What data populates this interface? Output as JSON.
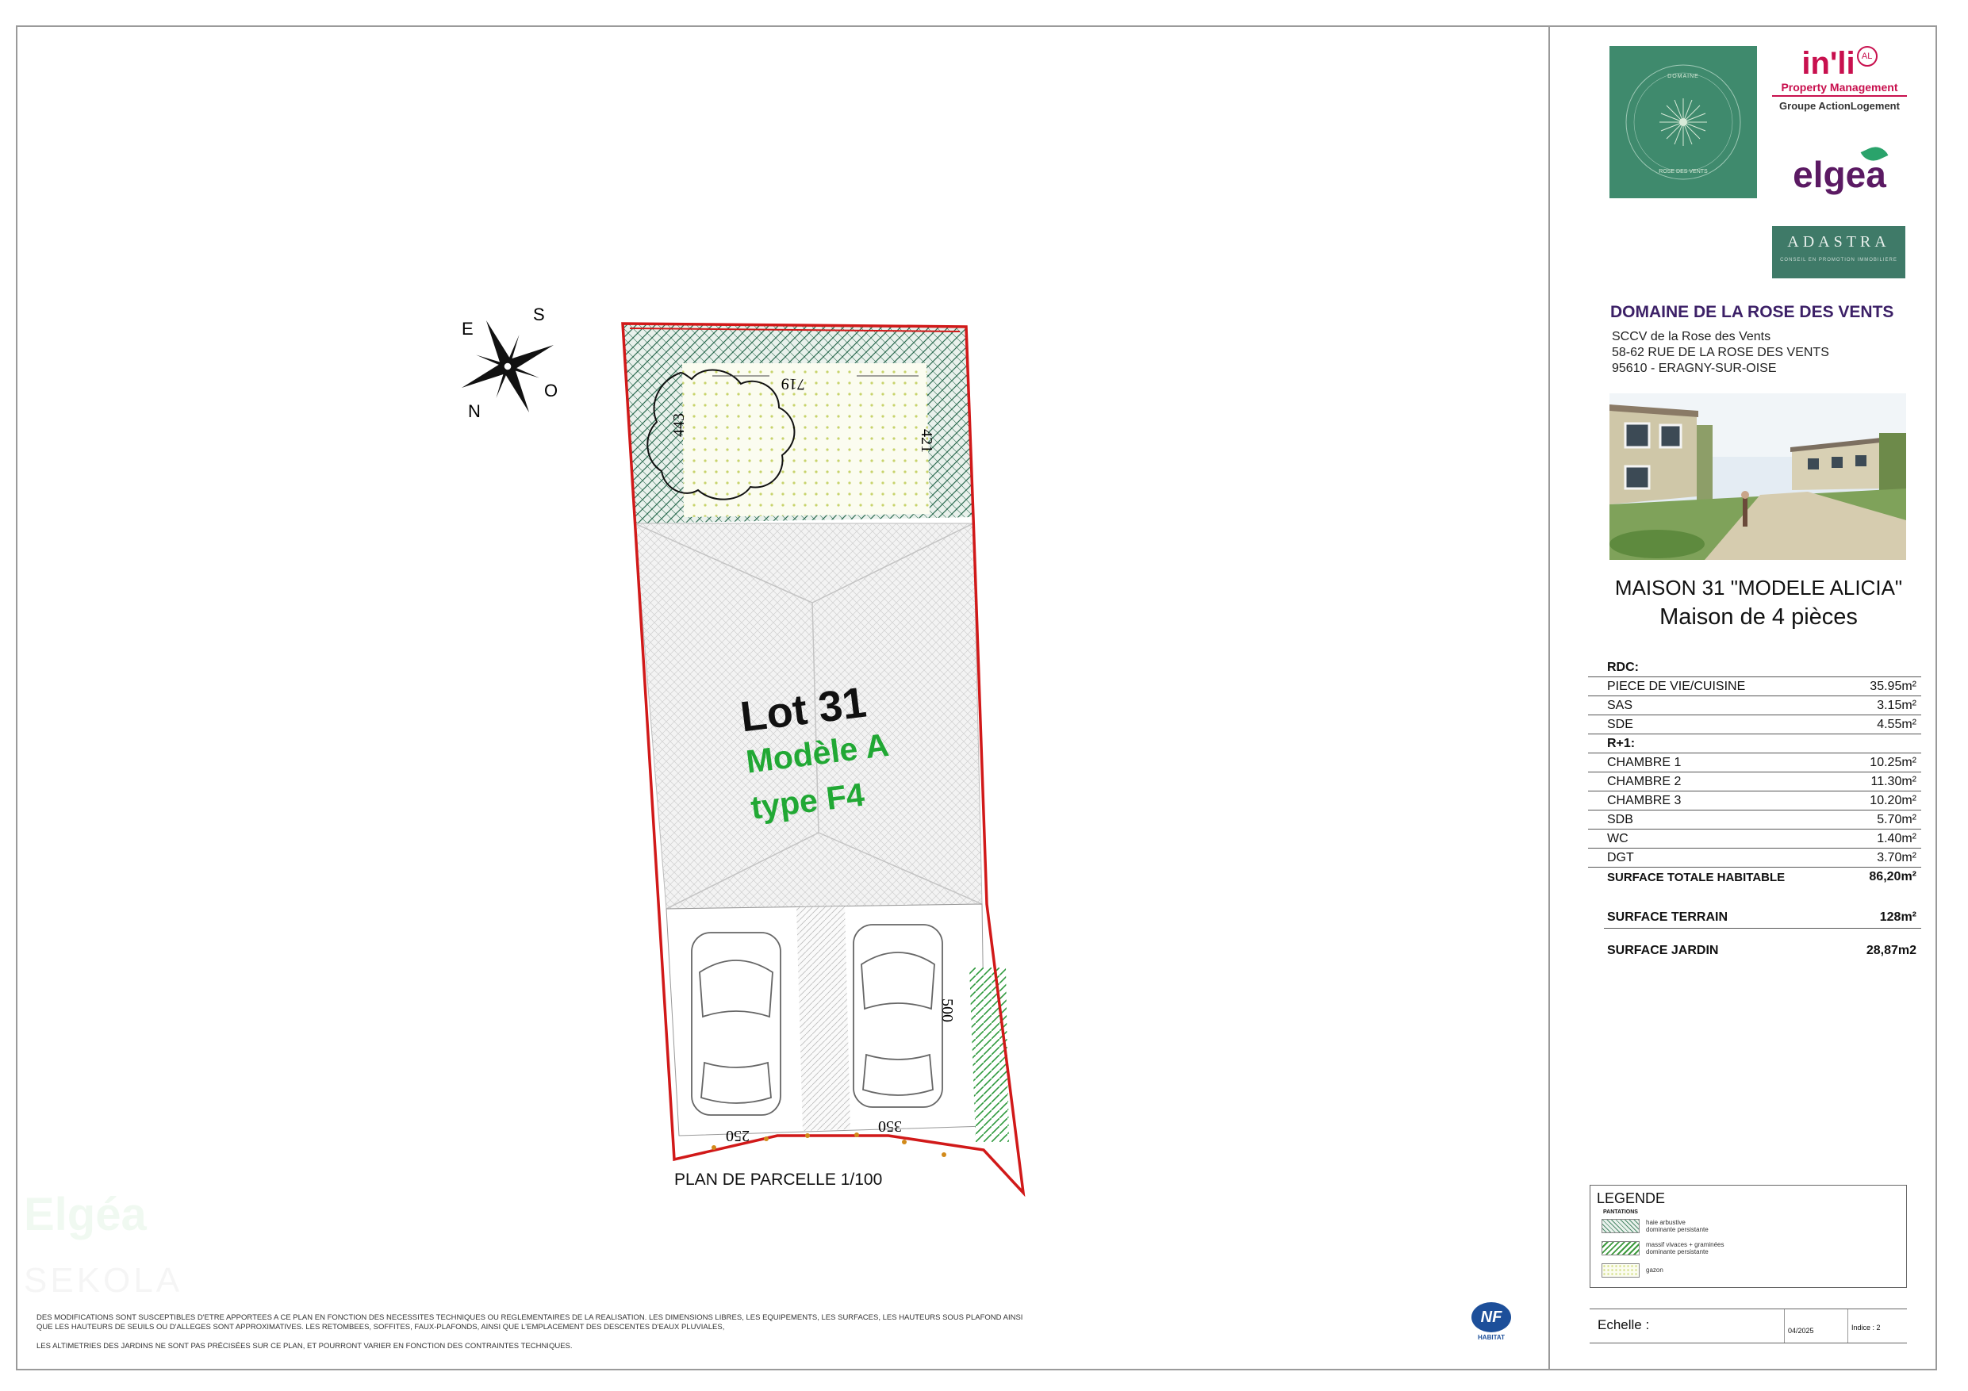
{
  "header": {
    "project_title": "DOMAINE DE LA ROSE DES VENTS",
    "address_lines": [
      "SCCV de la Rose des Vents",
      "58-62 RUE DE LA ROSE DES VENTS",
      "95610 - ERAGNY-SUR-OISE"
    ]
  },
  "logos": {
    "domaine": {
      "top": "DOMAINE",
      "bottom": "ROSE DES VENTS"
    },
    "inli": {
      "word": "in'li",
      "badge": "AL",
      "sub": "Property Management",
      "group": "Groupe ActionLogement"
    },
    "elgea": "elgea",
    "adastra": {
      "word": "ADASTRA",
      "sub": "CONSEIL EN PROMOTION IMMOBILIÈRE"
    }
  },
  "house": {
    "title": "MAISON 31 \"MODELE ALICIA\"",
    "subtitle": "Maison de 4 pièces"
  },
  "surfaces": {
    "rdc_label": "RDC:",
    "rdc": [
      {
        "name": "PIECE DE VIE/CUISINE",
        "value": "35.95m²"
      },
      {
        "name": "SAS",
        "value": "3.15m²"
      },
      {
        "name": "SDE",
        "value": "4.55m²"
      }
    ],
    "r1_label": "R+1:",
    "r1": [
      {
        "name": "CHAMBRE 1",
        "value": "10.25m²"
      },
      {
        "name": "CHAMBRE 2",
        "value": "11.30m²"
      },
      {
        "name": "CHAMBRE 3",
        "value": "10.20m²"
      },
      {
        "name": "SDB",
        "value": "5.70m²"
      },
      {
        "name": "WC",
        "value": "1.40m²"
      },
      {
        "name": "DGT",
        "value": "3.70m²"
      }
    ],
    "total_label": "SURFACE TOTALE HABITABLE",
    "total_value": "86,20m²",
    "terrain_label": "SURFACE TERRAIN",
    "terrain_value": "128m²",
    "jardin_label": "SURFACE JARDIN",
    "jardin_value": "28,87m2"
  },
  "legend": {
    "title": "LEGENDE",
    "subtitle": "PANTATIONS",
    "items": [
      {
        "text": "haie arbustive\ndominante persistante",
        "color": "#4c8a6a"
      },
      {
        "text": "massif vivaces + graminées\ndominante persistante",
        "color": "#3e9a3e"
      },
      {
        "text": "gazon",
        "color": "#d5e08a"
      }
    ]
  },
  "footer": {
    "echelle_label": "Echelle :",
    "date": "04/2025",
    "indice": "Indice : 2"
  },
  "disclaimer": {
    "line1": "DES MODIFICATIONS SONT SUSCEPTIBLES D'ETRE APPORTEES A CE PLAN EN FONCTION DES NECESSITES TECHNIQUES OU REGLEMENTAIRES DE LA REALISATION. LES DIMENSIONS LIBRES, LES EQUIPEMENTS, LES SURFACES, LES HAUTEURS SOUS PLAFOND AINSI",
    "line2": "QUE LES HAUTEURS DE SEUILS OU D'ALLEGES SONT APPROXIMATIVES. LES RETOMBEES, SOFFITES, FAUX-PLAFONDS, AINSI QUE L'EMPLACEMENT DES DESCENTES D'EAUX PLUVIALES,",
    "line3": "LES ALTIMETRIES DES JARDINS NE SONT PAS PRÉCISÉES SUR CE PLAN, ET POURRONT VARIER EN FONCTION DES CONTRAINTES TECHNIQUES."
  },
  "nf": {
    "mark": "NF",
    "label": "HABITAT"
  },
  "plan": {
    "caption": "PLAN DE PARCELLE 1/100",
    "lot": "Lot 31",
    "modele": "Modèle A",
    "type": "type F4",
    "dimensions": {
      "garden_width": "719",
      "garden_left": "443",
      "garden_right": "421",
      "parking_depth": "500",
      "parking_a": "250",
      "parking_b": "350"
    },
    "compass": {
      "n": "N",
      "s": "S",
      "e": "E",
      "o": "O"
    }
  },
  "watermarks": {
    "brand": "Elgéa",
    "secondary": "SEKOLA"
  }
}
